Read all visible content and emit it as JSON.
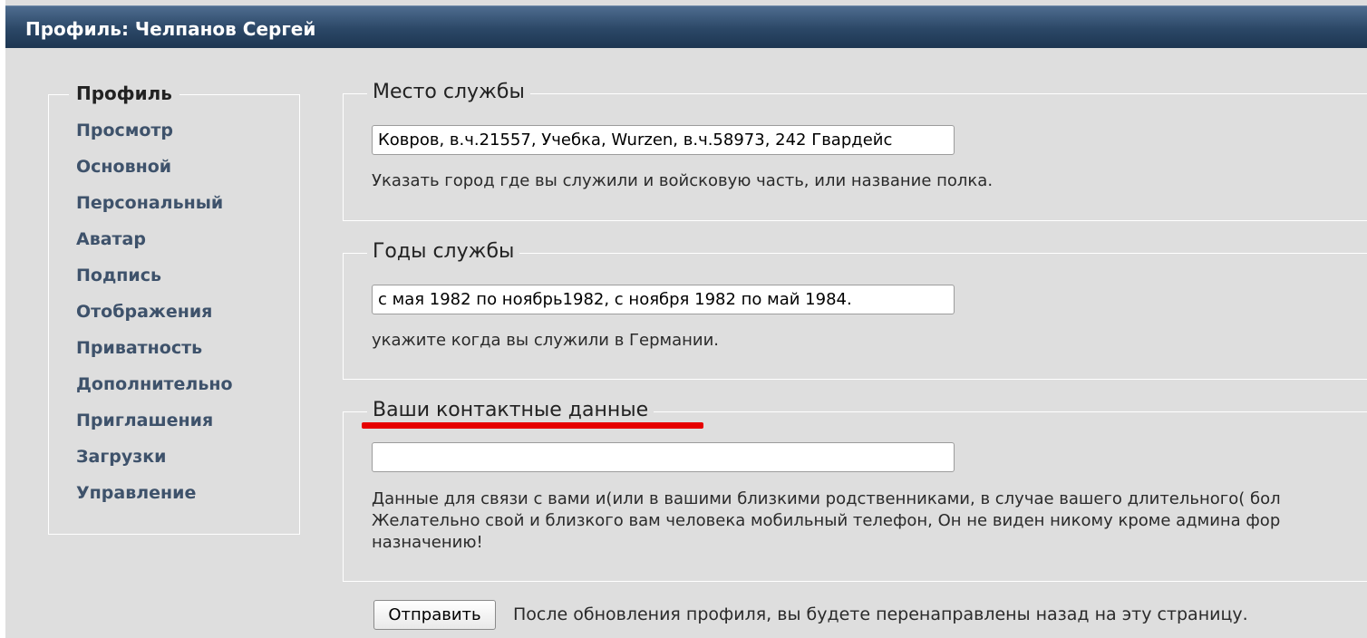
{
  "window": {
    "title": "Профиль: Челпанов Сергей"
  },
  "sidebar": {
    "heading": "Профиль",
    "items": [
      {
        "label": "Просмотр"
      },
      {
        "label": "Основной"
      },
      {
        "label": "Персональный"
      },
      {
        "label": "Аватар"
      },
      {
        "label": "Подпись"
      },
      {
        "label": "Отображения"
      },
      {
        "label": "Приватность"
      },
      {
        "label": "Дополнительно"
      },
      {
        "label": "Приглашения"
      },
      {
        "label": "Загрузки"
      },
      {
        "label": "Управление"
      }
    ]
  },
  "form": {
    "service_place": {
      "legend": "Место службы",
      "value": "Ковров, в.ч.21557, Учебка, Wurzen, в.ч.58973, 242 Гвардейс",
      "hint": "Указать город где вы служили и войсковую часть, или название полка."
    },
    "service_years": {
      "legend": "Годы службы",
      "value": "с мая 1982 по ноябрь1982, с ноября 1982 по май 1984.",
      "hint": "укажите когда вы служили в Германии."
    },
    "contacts": {
      "legend": "Ваши контактные данные",
      "value": "",
      "hint_line1": "Данные для связи с вами и(или в вашими близкими родственниками, в случае вашего длительного( бол",
      "hint_line2": "Желательно свой и близкого вам человека мобильный телефон, Он не виден никому кроме админа фор",
      "hint_line3": "назначению!",
      "highlight_color": "#e60000"
    },
    "submit_label": "Отправить",
    "submit_note": "После обновления профиля, вы будете перенаправлены назад на эту страницу."
  },
  "colors": {
    "title_bar": "#2b4766",
    "sidebar_link": "#3e526b",
    "background": "#dedede"
  }
}
